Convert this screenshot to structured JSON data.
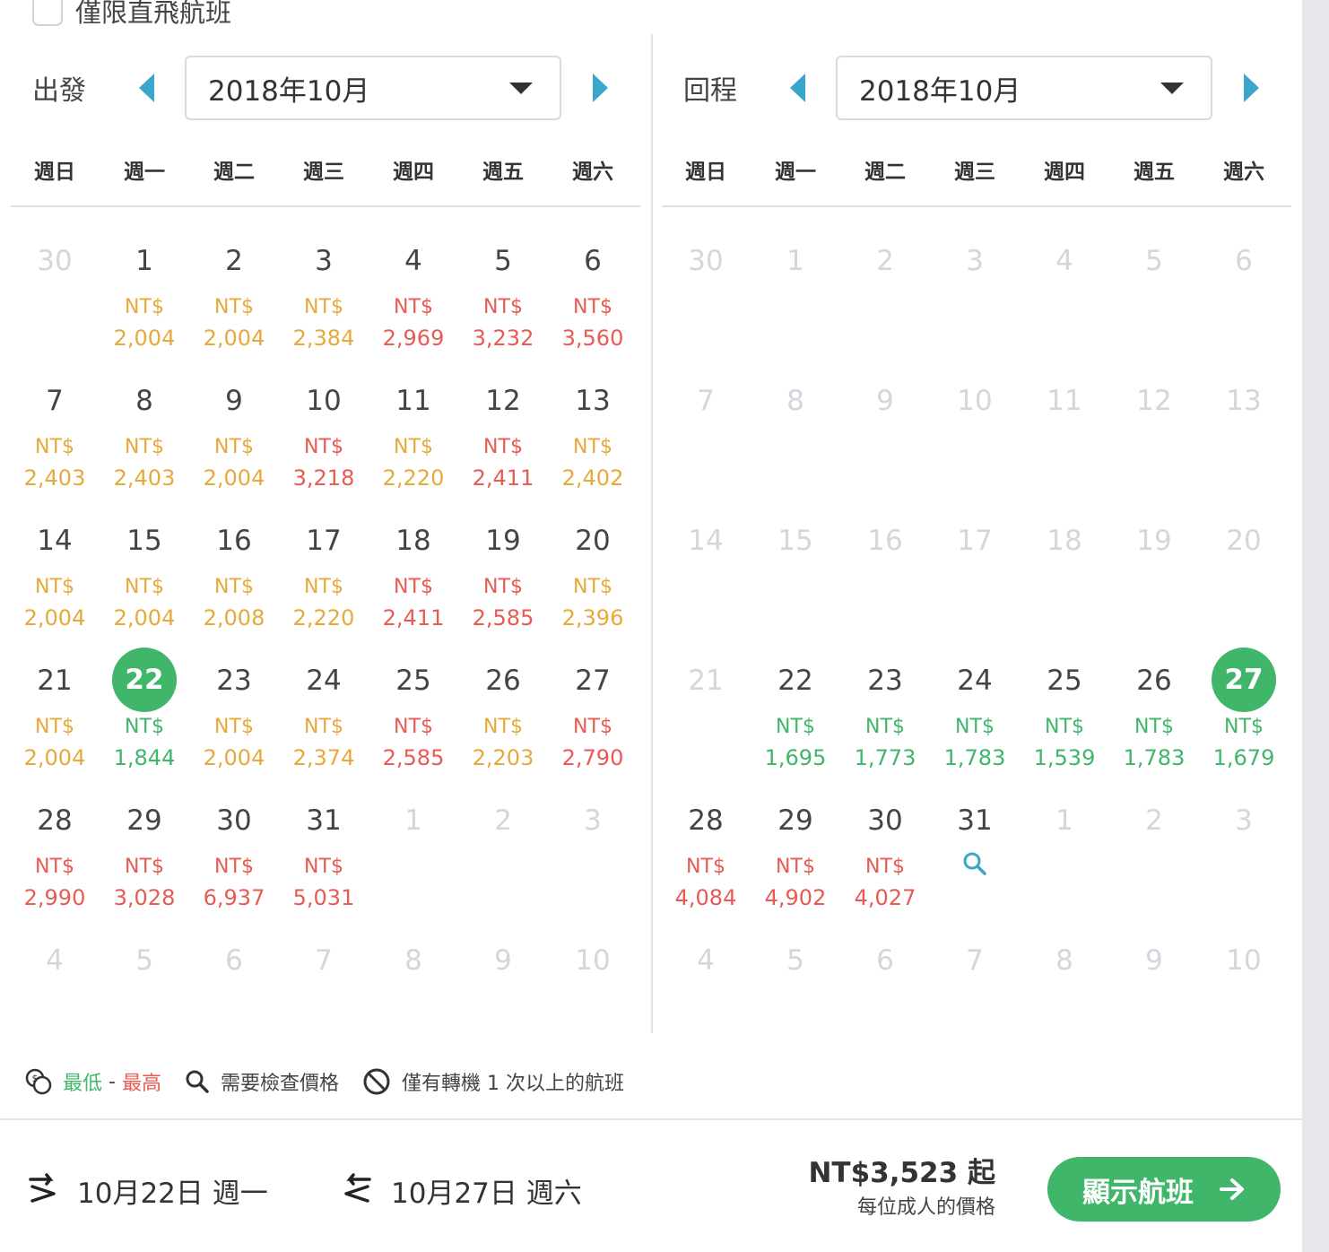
{
  "direct_only_label": "僅限直飛航班",
  "weekdays": [
    "週日",
    "週一",
    "週二",
    "週三",
    "週四",
    "週五",
    "週六"
  ],
  "price_currency": "NT$",
  "colors": {
    "cheap": "#3fb66a",
    "mid": "#e7a93a",
    "high": "#e85a52",
    "accent": "#3aa6c9"
  },
  "departure": {
    "label": "出發",
    "month": "2018年10月",
    "days": [
      {
        "d": "30",
        "m": true
      },
      {
        "d": "1",
        "p": "2,004",
        "c": "mid"
      },
      {
        "d": "2",
        "p": "2,004",
        "c": "mid"
      },
      {
        "d": "3",
        "p": "2,384",
        "c": "mid"
      },
      {
        "d": "4",
        "p": "2,969",
        "c": "high"
      },
      {
        "d": "5",
        "p": "3,232",
        "c": "high"
      },
      {
        "d": "6",
        "p": "3,560",
        "c": "high"
      },
      {
        "d": "7",
        "p": "2,403",
        "c": "mid"
      },
      {
        "d": "8",
        "p": "2,403",
        "c": "mid"
      },
      {
        "d": "9",
        "p": "2,004",
        "c": "mid"
      },
      {
        "d": "10",
        "p": "3,218",
        "c": "high"
      },
      {
        "d": "11",
        "p": "2,220",
        "c": "mid"
      },
      {
        "d": "12",
        "p": "2,411",
        "c": "high"
      },
      {
        "d": "13",
        "p": "2,402",
        "c": "mid"
      },
      {
        "d": "14",
        "p": "2,004",
        "c": "mid"
      },
      {
        "d": "15",
        "p": "2,004",
        "c": "mid"
      },
      {
        "d": "16",
        "p": "2,008",
        "c": "mid"
      },
      {
        "d": "17",
        "p": "2,220",
        "c": "mid"
      },
      {
        "d": "18",
        "p": "2,411",
        "c": "high"
      },
      {
        "d": "19",
        "p": "2,585",
        "c": "high"
      },
      {
        "d": "20",
        "p": "2,396",
        "c": "mid"
      },
      {
        "d": "21",
        "p": "2,004",
        "c": "mid"
      },
      {
        "d": "22",
        "p": "1,844",
        "c": "cheap",
        "sel": true
      },
      {
        "d": "23",
        "p": "2,004",
        "c": "mid"
      },
      {
        "d": "24",
        "p": "2,374",
        "c": "mid"
      },
      {
        "d": "25",
        "p": "2,585",
        "c": "high"
      },
      {
        "d": "26",
        "p": "2,203",
        "c": "mid"
      },
      {
        "d": "27",
        "p": "2,790",
        "c": "high"
      },
      {
        "d": "28",
        "p": "2,990",
        "c": "high"
      },
      {
        "d": "29",
        "p": "3,028",
        "c": "high"
      },
      {
        "d": "30",
        "p": "6,937",
        "c": "high"
      },
      {
        "d": "31",
        "p": "5,031",
        "c": "high"
      },
      {
        "d": "1",
        "m": true
      },
      {
        "d": "2",
        "m": true
      },
      {
        "d": "3",
        "m": true
      },
      {
        "d": "4",
        "m": true
      },
      {
        "d": "5",
        "m": true
      },
      {
        "d": "6",
        "m": true
      },
      {
        "d": "7",
        "m": true
      },
      {
        "d": "8",
        "m": true
      },
      {
        "d": "9",
        "m": true
      },
      {
        "d": "10",
        "m": true
      }
    ]
  },
  "return": {
    "label": "回程",
    "month": "2018年10月",
    "days": [
      {
        "d": "30",
        "m": true
      },
      {
        "d": "1",
        "m": true
      },
      {
        "d": "2",
        "m": true
      },
      {
        "d": "3",
        "m": true
      },
      {
        "d": "4",
        "m": true
      },
      {
        "d": "5",
        "m": true
      },
      {
        "d": "6",
        "m": true
      },
      {
        "d": "7",
        "m": true
      },
      {
        "d": "8",
        "m": true
      },
      {
        "d": "9",
        "m": true
      },
      {
        "d": "10",
        "m": true
      },
      {
        "d": "11",
        "m": true
      },
      {
        "d": "12",
        "m": true
      },
      {
        "d": "13",
        "m": true
      },
      {
        "d": "14",
        "m": true
      },
      {
        "d": "15",
        "m": true
      },
      {
        "d": "16",
        "m": true
      },
      {
        "d": "17",
        "m": true
      },
      {
        "d": "18",
        "m": true
      },
      {
        "d": "19",
        "m": true
      },
      {
        "d": "20",
        "m": true
      },
      {
        "d": "21",
        "m": true
      },
      {
        "d": "22",
        "p": "1,695",
        "c": "cheap"
      },
      {
        "d": "23",
        "p": "1,773",
        "c": "cheap"
      },
      {
        "d": "24",
        "p": "1,783",
        "c": "cheap"
      },
      {
        "d": "25",
        "p": "1,539",
        "c": "cheap"
      },
      {
        "d": "26",
        "p": "1,783",
        "c": "cheap"
      },
      {
        "d": "27",
        "p": "1,679",
        "c": "cheap",
        "sel": true
      },
      {
        "d": "28",
        "p": "4,084",
        "c": "high"
      },
      {
        "d": "29",
        "p": "4,902",
        "c": "high"
      },
      {
        "d": "30",
        "p": "4,027",
        "c": "high"
      },
      {
        "d": "31",
        "search": true
      },
      {
        "d": "1",
        "m": true
      },
      {
        "d": "2",
        "m": true
      },
      {
        "d": "3",
        "m": true
      },
      {
        "d": "4",
        "m": true
      },
      {
        "d": "5",
        "m": true
      },
      {
        "d": "6",
        "m": true
      },
      {
        "d": "7",
        "m": true
      },
      {
        "d": "8",
        "m": true
      },
      {
        "d": "9",
        "m": true
      },
      {
        "d": "10",
        "m": true
      }
    ]
  },
  "legend": {
    "low": "最低",
    "sep": " - ",
    "high": "最高",
    "check_price": "需要檢查價格",
    "connecting": "僅有轉機 1 次以上的航班"
  },
  "summary": {
    "depart_date": "10月22日 週一",
    "return_date": "10月27日 週六",
    "total_price": "NT$3,523 起",
    "price_note": "每位成人的價格",
    "cta_label": "顯示航班"
  }
}
